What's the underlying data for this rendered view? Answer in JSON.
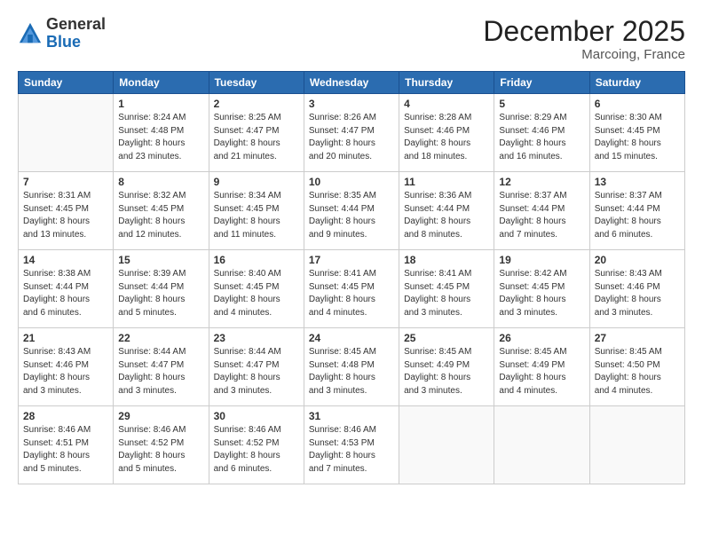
{
  "logo": {
    "general": "General",
    "blue": "Blue"
  },
  "header": {
    "title": "December 2025",
    "subtitle": "Marcoing, France"
  },
  "weekdays": [
    "Sunday",
    "Monday",
    "Tuesday",
    "Wednesday",
    "Thursday",
    "Friday",
    "Saturday"
  ],
  "weeks": [
    [
      {
        "day": "",
        "info": ""
      },
      {
        "day": "1",
        "info": "Sunrise: 8:24 AM\nSunset: 4:48 PM\nDaylight: 8 hours\nand 23 minutes."
      },
      {
        "day": "2",
        "info": "Sunrise: 8:25 AM\nSunset: 4:47 PM\nDaylight: 8 hours\nand 21 minutes."
      },
      {
        "day": "3",
        "info": "Sunrise: 8:26 AM\nSunset: 4:47 PM\nDaylight: 8 hours\nand 20 minutes."
      },
      {
        "day": "4",
        "info": "Sunrise: 8:28 AM\nSunset: 4:46 PM\nDaylight: 8 hours\nand 18 minutes."
      },
      {
        "day": "5",
        "info": "Sunrise: 8:29 AM\nSunset: 4:46 PM\nDaylight: 8 hours\nand 16 minutes."
      },
      {
        "day": "6",
        "info": "Sunrise: 8:30 AM\nSunset: 4:45 PM\nDaylight: 8 hours\nand 15 minutes."
      }
    ],
    [
      {
        "day": "7",
        "info": "Sunrise: 8:31 AM\nSunset: 4:45 PM\nDaylight: 8 hours\nand 13 minutes."
      },
      {
        "day": "8",
        "info": "Sunrise: 8:32 AM\nSunset: 4:45 PM\nDaylight: 8 hours\nand 12 minutes."
      },
      {
        "day": "9",
        "info": "Sunrise: 8:34 AM\nSunset: 4:45 PM\nDaylight: 8 hours\nand 11 minutes."
      },
      {
        "day": "10",
        "info": "Sunrise: 8:35 AM\nSunset: 4:44 PM\nDaylight: 8 hours\nand 9 minutes."
      },
      {
        "day": "11",
        "info": "Sunrise: 8:36 AM\nSunset: 4:44 PM\nDaylight: 8 hours\nand 8 minutes."
      },
      {
        "day": "12",
        "info": "Sunrise: 8:37 AM\nSunset: 4:44 PM\nDaylight: 8 hours\nand 7 minutes."
      },
      {
        "day": "13",
        "info": "Sunrise: 8:37 AM\nSunset: 4:44 PM\nDaylight: 8 hours\nand 6 minutes."
      }
    ],
    [
      {
        "day": "14",
        "info": "Sunrise: 8:38 AM\nSunset: 4:44 PM\nDaylight: 8 hours\nand 6 minutes."
      },
      {
        "day": "15",
        "info": "Sunrise: 8:39 AM\nSunset: 4:44 PM\nDaylight: 8 hours\nand 5 minutes."
      },
      {
        "day": "16",
        "info": "Sunrise: 8:40 AM\nSunset: 4:45 PM\nDaylight: 8 hours\nand 4 minutes."
      },
      {
        "day": "17",
        "info": "Sunrise: 8:41 AM\nSunset: 4:45 PM\nDaylight: 8 hours\nand 4 minutes."
      },
      {
        "day": "18",
        "info": "Sunrise: 8:41 AM\nSunset: 4:45 PM\nDaylight: 8 hours\nand 3 minutes."
      },
      {
        "day": "19",
        "info": "Sunrise: 8:42 AM\nSunset: 4:45 PM\nDaylight: 8 hours\nand 3 minutes."
      },
      {
        "day": "20",
        "info": "Sunrise: 8:43 AM\nSunset: 4:46 PM\nDaylight: 8 hours\nand 3 minutes."
      }
    ],
    [
      {
        "day": "21",
        "info": "Sunrise: 8:43 AM\nSunset: 4:46 PM\nDaylight: 8 hours\nand 3 minutes."
      },
      {
        "day": "22",
        "info": "Sunrise: 8:44 AM\nSunset: 4:47 PM\nDaylight: 8 hours\nand 3 minutes."
      },
      {
        "day": "23",
        "info": "Sunrise: 8:44 AM\nSunset: 4:47 PM\nDaylight: 8 hours\nand 3 minutes."
      },
      {
        "day": "24",
        "info": "Sunrise: 8:45 AM\nSunset: 4:48 PM\nDaylight: 8 hours\nand 3 minutes."
      },
      {
        "day": "25",
        "info": "Sunrise: 8:45 AM\nSunset: 4:49 PM\nDaylight: 8 hours\nand 3 minutes."
      },
      {
        "day": "26",
        "info": "Sunrise: 8:45 AM\nSunset: 4:49 PM\nDaylight: 8 hours\nand 4 minutes."
      },
      {
        "day": "27",
        "info": "Sunrise: 8:45 AM\nSunset: 4:50 PM\nDaylight: 8 hours\nand 4 minutes."
      }
    ],
    [
      {
        "day": "28",
        "info": "Sunrise: 8:46 AM\nSunset: 4:51 PM\nDaylight: 8 hours\nand 5 minutes."
      },
      {
        "day": "29",
        "info": "Sunrise: 8:46 AM\nSunset: 4:52 PM\nDaylight: 8 hours\nand 5 minutes."
      },
      {
        "day": "30",
        "info": "Sunrise: 8:46 AM\nSunset: 4:52 PM\nDaylight: 8 hours\nand 6 minutes."
      },
      {
        "day": "31",
        "info": "Sunrise: 8:46 AM\nSunset: 4:53 PM\nDaylight: 8 hours\nand 7 minutes."
      },
      {
        "day": "",
        "info": ""
      },
      {
        "day": "",
        "info": ""
      },
      {
        "day": "",
        "info": ""
      }
    ]
  ]
}
